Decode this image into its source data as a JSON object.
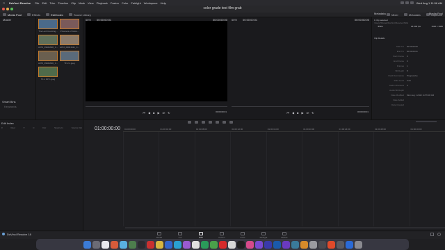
{
  "macbar": {
    "app": "DaVinci Resolve",
    "menus": [
      "File",
      "Edit",
      "Trim",
      "Timeline",
      "Clip",
      "Mark",
      "View",
      "Playback",
      "Fusion",
      "Color",
      "Fairlight",
      "Workspace",
      "Help"
    ],
    "datetime": "Wed Aug 1  11:56 AM"
  },
  "window": {
    "title": "color grade test film grab"
  },
  "toolbar": {
    "left": [
      {
        "label": "Media Pool",
        "icon": "media-pool-icon",
        "active": true
      },
      {
        "label": "Effects",
        "icon": "effects-icon",
        "active": false
      },
      {
        "label": "Edit Index",
        "icon": "edit-index-icon",
        "active": true
      },
      {
        "label": "Sound Library",
        "icon": "sound-library-icon",
        "active": false
      }
    ],
    "right": [
      {
        "label": "Mixer",
        "icon": "mixer-icon"
      },
      {
        "label": "Metadata",
        "icon": "metadata-icon"
      },
      {
        "label": "Inspector",
        "icon": "inspector-icon"
      }
    ]
  },
  "leftpanel": {
    "master": "Master",
    "smart_bins": "Smart Bins",
    "keywords": "Keywords"
  },
  "bin": {
    "clips": [
      {
        "name": "The Lord Counting...",
        "color": "#4a6a8a"
      },
      {
        "name": "Prisoners of Ghos...",
        "color": "#7a5a5a"
      },
      {
        "name": "A073_09041600_C...",
        "color": "#5f6f5a"
      },
      {
        "name": "A072_09041611_C...",
        "color": "#8a7a6a"
      },
      {
        "name": "A070_09041600_C...",
        "color": "#6a5f4f"
      },
      {
        "name": "TF 2-1.jpeg",
        "color": "#5a6a7a"
      },
      {
        "name": "TF-1 DP 1.jpeg",
        "color": "#4f6a4a"
      }
    ]
  },
  "source": {
    "zoom": "66%",
    "tc_left": "00:00:00:01",
    "tc_right": "00:00:00:00",
    "ctrl_tc": "00:00:00:01"
  },
  "program": {
    "zoom": "66%",
    "tc_left": "00:00:00:01",
    "tc_right": "00:00:00:00",
    "ctrl_tc": "00:00:00:01"
  },
  "metadata": {
    "title": "Metadata",
    "media_pool": "Media Pool",
    "clip_selected": "1 Clip selected",
    "clip_path": "/Users/Shared/DaVinci/Resolve/Stills",
    "format": "JPEG",
    "fps": "24.000 fps",
    "res": "1920 x 1080",
    "details_title": "Clip Details",
    "rows": [
      {
        "k": "Start TC",
        "v": "00:00:00:00"
      },
      {
        "k": "End TC",
        "v": "00:00:00:01"
      },
      {
        "k": "Start Frame",
        "v": "0"
      },
      {
        "k": "End Frame",
        "v": "0"
      },
      {
        "k": "Frames",
        "v": "1"
      },
      {
        "k": "Bit Depth",
        "v": "8"
      },
      {
        "k": "Field Dominance",
        "v": "Progressive"
      },
      {
        "k": "Data Level",
        "v": "Auto"
      },
      {
        "k": "Audio Channels",
        "v": "0"
      },
      {
        "k": "Audio Bit Depth",
        "v": ""
      },
      {
        "k": "Date Modified",
        "v": "Mon Aug 1 2022 11:55:38 AM"
      },
      {
        "k": "Date Added",
        "v": ""
      },
      {
        "k": "Date Created",
        "v": ""
      }
    ]
  },
  "editindex": {
    "title": "Edit Index",
    "cols": [
      "#",
      "Reel",
      "V",
      "C",
      "Dur",
      "Source In",
      "Source Out"
    ]
  },
  "timeline": {
    "tc": "01:00:00:00",
    "ticks": [
      "01:00:00:00",
      "01:00:04:00",
      "01:00:08:00",
      "01:00:12:00",
      "01:00:16:00",
      "01:00:20:00",
      "01:00:24:00",
      "01:00:28:00",
      "01:00:32:00"
    ]
  },
  "bottombar": {
    "label": "DaVinci Resolve 18"
  },
  "pages": [
    {
      "label": "Media",
      "active": false
    },
    {
      "label": "Cut",
      "active": false
    },
    {
      "label": "Edit",
      "active": true
    },
    {
      "label": "Fusion",
      "active": false
    },
    {
      "label": "Color",
      "active": false
    },
    {
      "label": "Fairlight",
      "active": false
    },
    {
      "label": "Deliver",
      "active": false
    }
  ],
  "dock": [
    "#3b7bd6",
    "#6b6b75",
    "#e8e8ee",
    "#d65b3a",
    "#5ab0e0",
    "#4d7d4d",
    "#2a2a30",
    "#c83030",
    "#d6b640",
    "#3366cc",
    "#2aa0d0",
    "#9a5ad0",
    "#e0e0e0",
    "#2a9a5a",
    "#4aa04a",
    "#d62a2a",
    "#d6d6d6",
    "#1f1f1f",
    "#d64a8a",
    "#7a4ad0",
    "#3a3aaa",
    "#1a5aaa",
    "#6a3ac0",
    "#3a7a9a",
    "#d68a2a",
    "#9a9aa0",
    "#4a4a50",
    "#e04a2a",
    "#5a5a60",
    "#2a6ad6",
    "#8a8a90"
  ]
}
